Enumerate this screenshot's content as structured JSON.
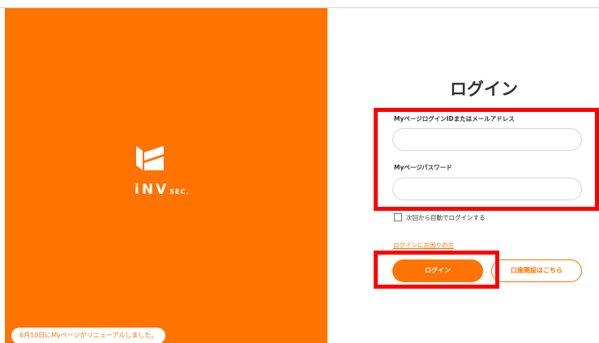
{
  "brand": {
    "logo_text": "iNV",
    "logo_suffix": "SEC.",
    "notice": "6月10日にMyページがリニューアルしました。"
  },
  "login": {
    "title": "ログイン",
    "id_label": "MyページログインIDまたはメールアドレス",
    "id_value": "",
    "password_label": "Myページパスワード",
    "password_value": "",
    "auto_login_label": "次回から自動でログインする",
    "auto_login_checked": false,
    "trouble_link": "ログインにお困りの方",
    "login_button": "ログイン",
    "open_account_button": "口座開設はこちら"
  },
  "colors": {
    "brand_orange": "#ff7300",
    "highlight_red": "#ff0000"
  }
}
